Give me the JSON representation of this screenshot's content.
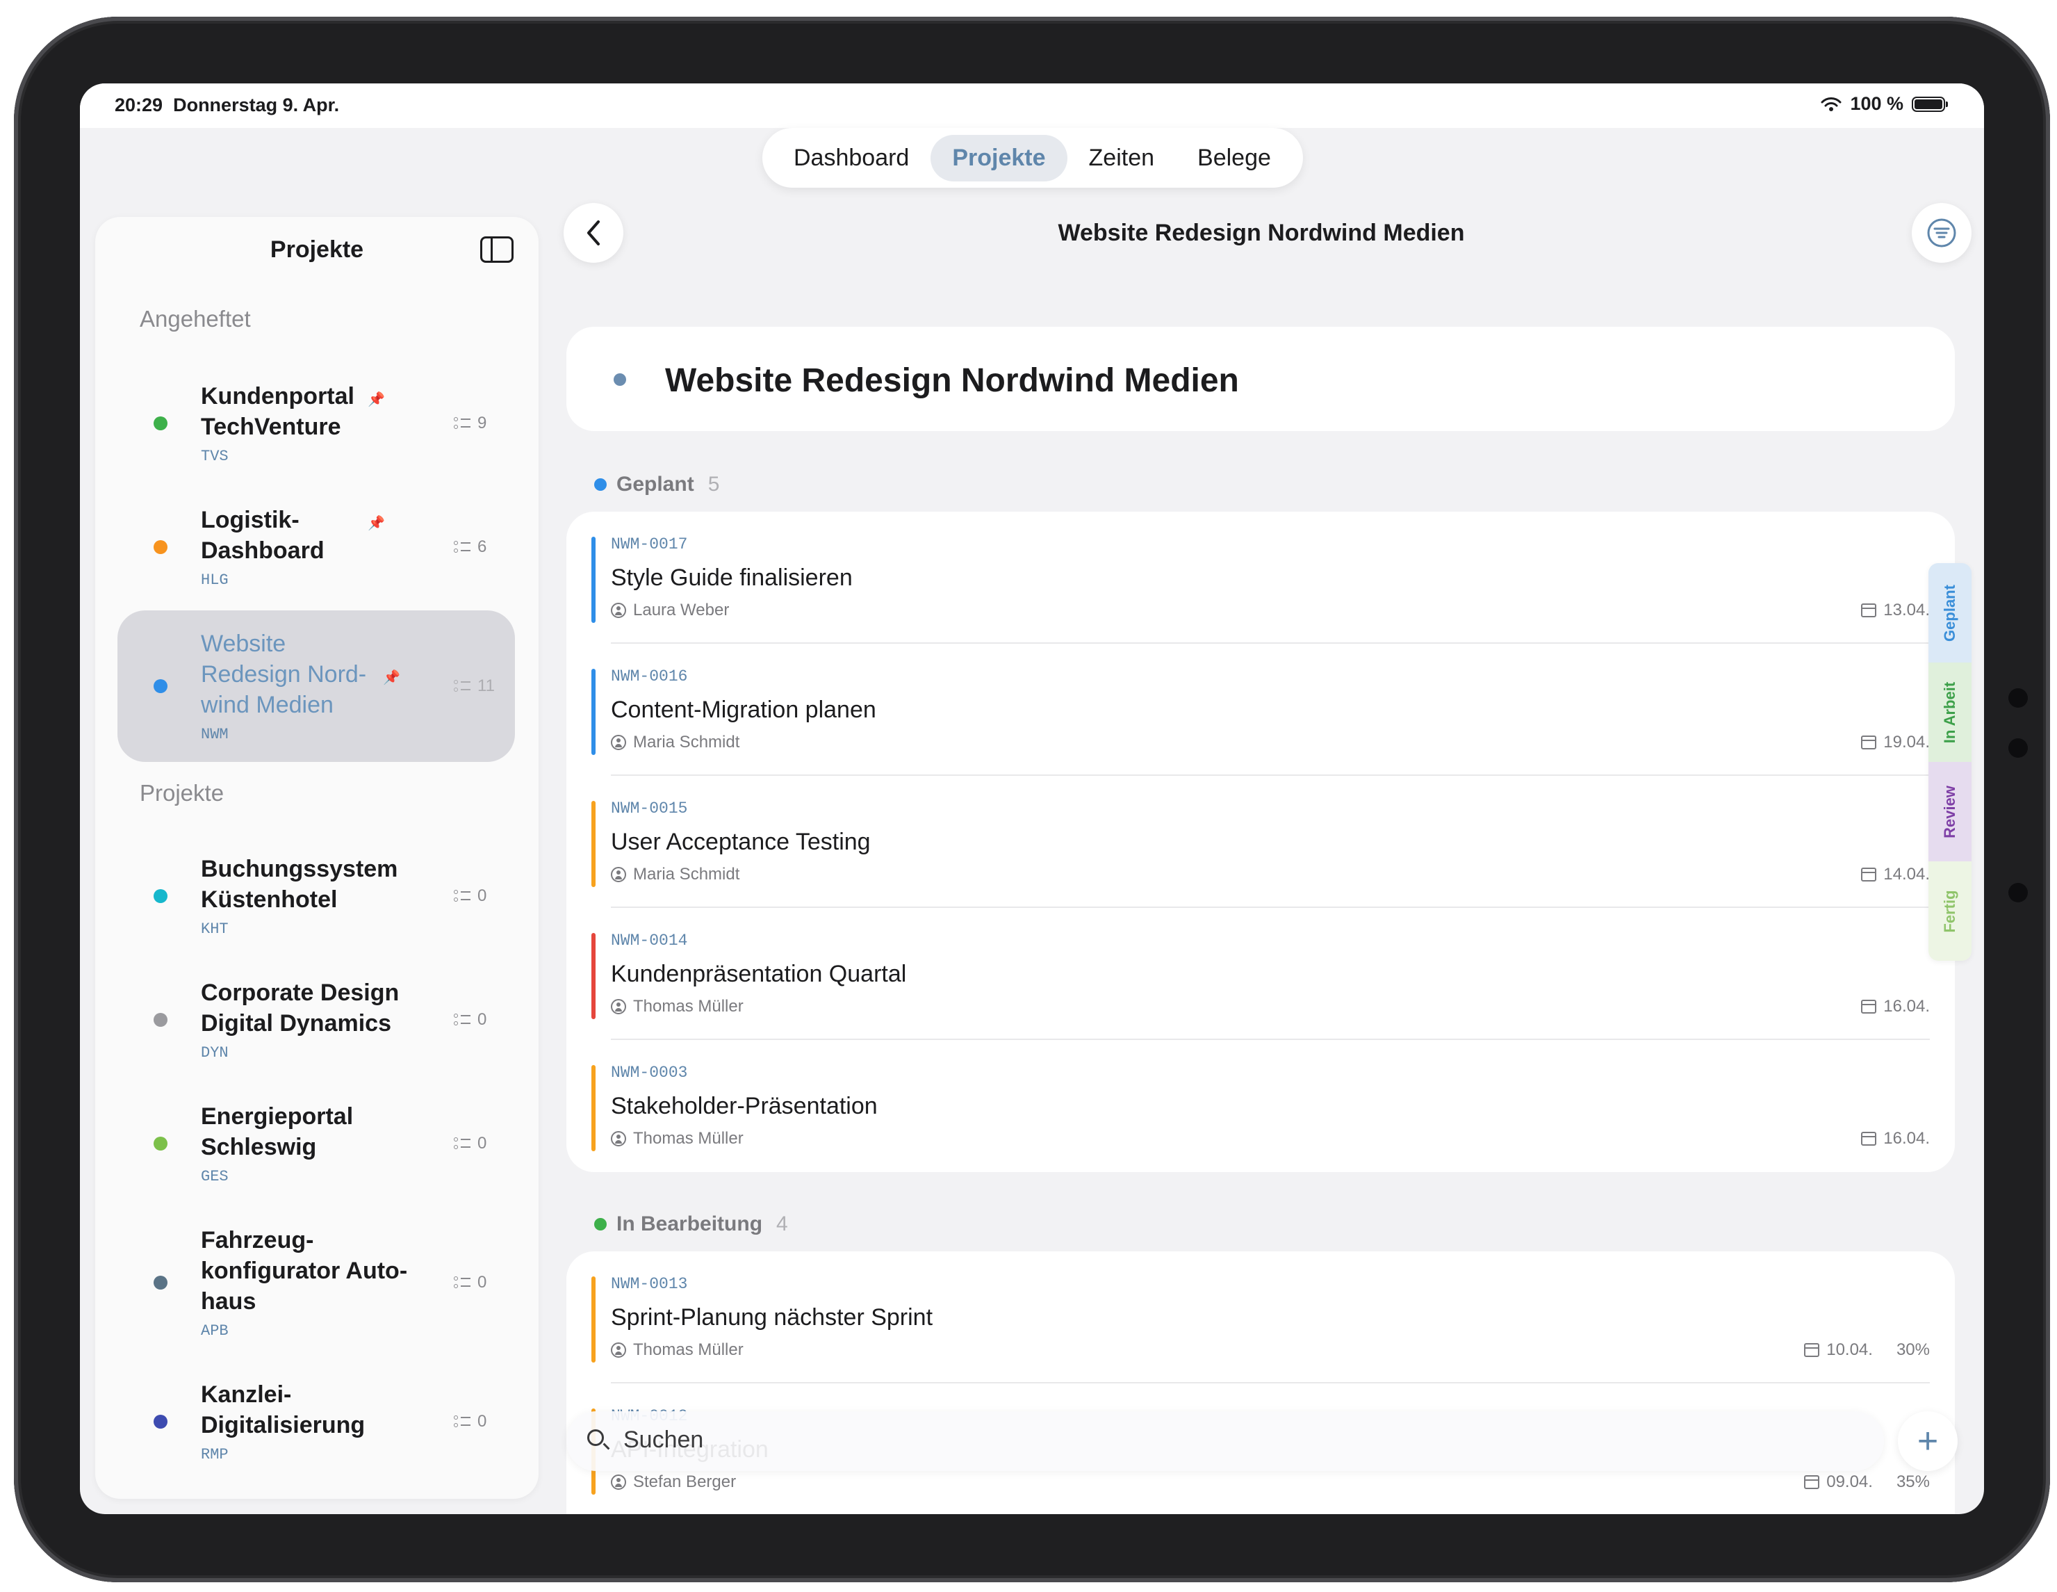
{
  "status_bar": {
    "time": "20:29",
    "date": "Donnerstag 9. Apr.",
    "battery": "100 %"
  },
  "tabs": [
    {
      "label": "Dashboard",
      "active": false
    },
    {
      "label": "Projekte",
      "active": true
    },
    {
      "label": "Zeiten",
      "active": false
    },
    {
      "label": "Belege",
      "active": false
    }
  ],
  "sidebar": {
    "title": "Projekte",
    "pinned_heading": "Angeheftet",
    "projects_heading": "Projekte",
    "pinned": [
      {
        "lines": [
          "Kundenportal",
          "TechVenture"
        ],
        "code": "TVS",
        "count": "9",
        "color": "#3db04a"
      },
      {
        "lines": [
          "Logistik-",
          "Dashboard"
        ],
        "code": "HLG",
        "count": "6",
        "color": "#f7931e"
      },
      {
        "lines": [
          "Website",
          "Redesign Nord-",
          "wind Medien"
        ],
        "code": "NWM",
        "count": "11",
        "color": "#2f8ee8",
        "selected": true
      }
    ],
    "projects": [
      {
        "lines": [
          "Buchungssystem",
          "Küstenhotel"
        ],
        "code": "KHT",
        "count": "0",
        "color": "#16b7cc"
      },
      {
        "lines": [
          "Corporate Design",
          "Digital Dynamics"
        ],
        "code": "DYN",
        "count": "0",
        "color": "#9a9a9e"
      },
      {
        "lines": [
          "Energieportal",
          "Schleswig"
        ],
        "code": "GES",
        "count": "0",
        "color": "#7cc04a"
      },
      {
        "lines": [
          "Fahrzeug-",
          "konfigurator Auto-",
          "haus"
        ],
        "code": "APB",
        "count": "0",
        "color": "#5a7386"
      },
      {
        "lines": [
          "Kanzlei-",
          "Digitalisierung"
        ],
        "code": "RMP",
        "count": "0",
        "color": "#3d4bb0"
      }
    ]
  },
  "main": {
    "nav_title": "Website Redesign Nordwind Medien",
    "project_title": "Website Redesign Nordwind Medien",
    "groups": [
      {
        "name": "Geplant",
        "count": "5",
        "color": "#2f8ee8",
        "tasks": [
          {
            "id": "NWM-0017",
            "title": "Style Guide finalisieren",
            "assignee": "Laura Weber",
            "date": "13.04.",
            "bar": "#2f8ee8"
          },
          {
            "id": "NWM-0016",
            "title": "Content-Migration planen",
            "assignee": "Maria Schmidt",
            "date": "19.04.",
            "bar": "#2f8ee8"
          },
          {
            "id": "NWM-0015",
            "title": "User Acceptance Testing",
            "assignee": "Maria Schmidt",
            "date": "14.04.",
            "bar": "#f7a21e"
          },
          {
            "id": "NWM-0014",
            "title": "Kundenpräsentation Quartal",
            "assignee": "Thomas Müller",
            "date": "16.04.",
            "bar": "#e5463c"
          },
          {
            "id": "NWM-0003",
            "title": "Stakeholder-Präsentation",
            "assignee": "Thomas Müller",
            "date": "16.04.",
            "bar": "#f7a21e"
          }
        ]
      },
      {
        "name": "In Bearbeitung",
        "count": "4",
        "color": "#3db04a",
        "tasks": [
          {
            "id": "NWM-0013",
            "title": "Sprint-Planung nächster Sprint",
            "assignee": "Thomas Müller",
            "date": "10.04.",
            "progress": "30%",
            "bar": "#f7a21e"
          },
          {
            "id": "NWM-0012",
            "title": "API-Integration",
            "assignee": "Stefan Berger",
            "date": "09.04.",
            "progress": "35%",
            "bar": "#f7a21e"
          }
        ]
      }
    ],
    "rail": [
      {
        "label": "Geplant",
        "bg": "#dbe9f7",
        "fg": "#3a8ed8"
      },
      {
        "label": "In Arbeit",
        "bg": "#e0f0dc",
        "fg": "#3da04a"
      },
      {
        "label": "Review",
        "bg": "#e6dcef",
        "fg": "#7e3fa6"
      },
      {
        "label": "Fertig",
        "bg": "#edf5e4",
        "fg": "#8fc46a"
      }
    ],
    "search_placeholder": "Suchen"
  }
}
